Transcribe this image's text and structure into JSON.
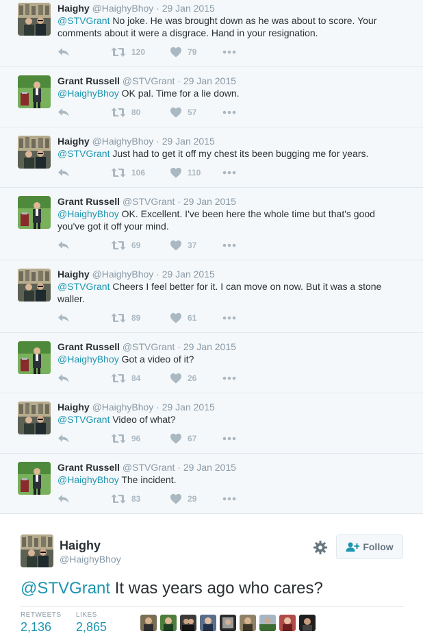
{
  "tweets": [
    {
      "name": "Haighy",
      "handle": "@HaighyBhoy",
      "date": "· 29 Jan 2015",
      "mention": "@STVGrant",
      "text": " No joke. He was brought down as he was about to score. Your comments about it were a disgrace. Hand in your resignation.",
      "retweets": "120",
      "likes": "79"
    },
    {
      "name": "Grant Russell",
      "handle": "@STVGrant",
      "date": "· 29 Jan 2015",
      "mention": "@HaighyBhoy",
      "text": " OK pal. Time for a lie down.",
      "retweets": "80",
      "likes": "57"
    },
    {
      "name": "Haighy",
      "handle": "@HaighyBhoy",
      "date": "· 29 Jan 2015",
      "mention": "@STVGrant",
      "text": " Just had to get it off my chest its been bugging me for years.",
      "retweets": "106",
      "likes": "110"
    },
    {
      "name": "Grant Russell",
      "handle": "@STVGrant",
      "date": "· 29 Jan 2015",
      "mention": "@HaighyBhoy",
      "text": " OK. Excellent. I've been here the whole time but that's good you've got it off your mind.",
      "retweets": "69",
      "likes": "37"
    },
    {
      "name": "Haighy",
      "handle": "@HaighyBhoy",
      "date": "· 29 Jan 2015",
      "mention": "@STVGrant",
      "text": " Cheers I feel better for it. I can move on now. But it was a stone waller.",
      "retweets": "89",
      "likes": "61"
    },
    {
      "name": "Grant Russell",
      "handle": "@STVGrant",
      "date": "· 29 Jan 2015",
      "mention": "@HaighyBhoy",
      "text": " Got a video of it?",
      "retweets": "84",
      "likes": "26"
    },
    {
      "name": "Haighy",
      "handle": "@HaighyBhoy",
      "date": "· 29 Jan 2015",
      "mention": "@STVGrant",
      "text": " Video of what?",
      "retweets": "96",
      "likes": "67"
    },
    {
      "name": "Grant Russell",
      "handle": "@STVGrant",
      "date": "· 29 Jan 2015",
      "mention": "@HaighyBhoy",
      "text": " The incident.",
      "retweets": "83",
      "likes": "29"
    }
  ],
  "main_tweet": {
    "name": "Haighy",
    "handle": "@HaighyBhoy",
    "mention": "@STVGrant",
    "text": " It was years ago who cares?",
    "follow_label": "Follow",
    "retweets_label": "RETWEETS",
    "retweets": "2,136",
    "likes_label": "LIKES",
    "likes": "2,865"
  },
  "icons": {
    "reply": "reply-arrow-icon",
    "retweet": "retweet-icon",
    "like": "heart-icon",
    "more": "more-dots-icon",
    "settings": "gear-icon",
    "follow": "add-user-icon"
  },
  "colors": {
    "mention": "#1b95b0",
    "action_grey": "#aab8c2",
    "meta_grey": "#8899a6",
    "text": "#292f33"
  }
}
